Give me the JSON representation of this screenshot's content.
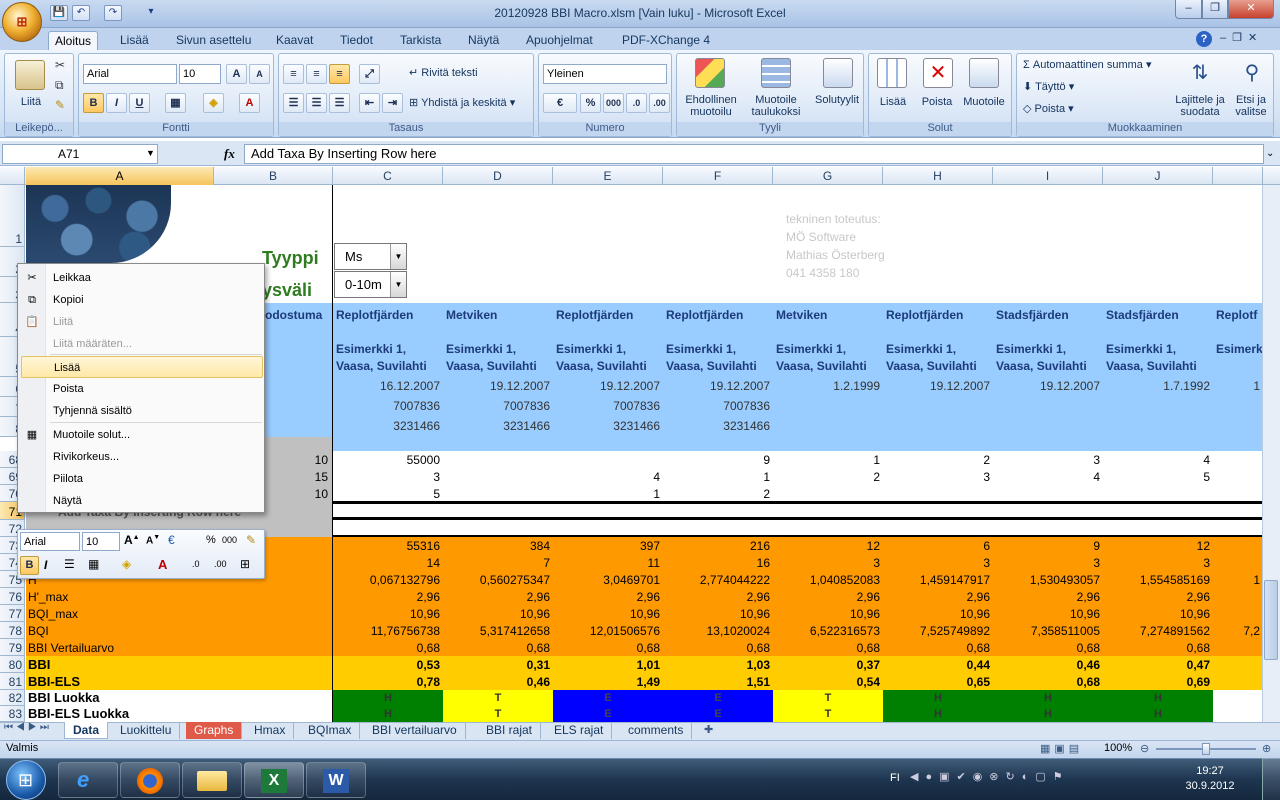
{
  "window": {
    "title": "20120928 BBI Macro.xlsm  [Vain luku] - Microsoft Excel",
    "min": "–",
    "max": "❐",
    "close": "✕"
  },
  "qat": {
    "save": "💾",
    "undo": "↶",
    "redo": "↷",
    "more": "▾"
  },
  "tabs": [
    "Aloitus",
    "Lisää",
    "Sivun asettelu",
    "Kaavat",
    "Tiedot",
    "Tarkista",
    "Näytä",
    "Apuohjelmat",
    "PDF-XChange 4"
  ],
  "ribbon": {
    "clipboard": {
      "label": "Leikepö...",
      "paste": "Liitä"
    },
    "font": {
      "label": "Fontti",
      "name": "Arial",
      "size": "10",
      "bold": "B",
      "italic": "I",
      "underline": "U",
      "grow": "A",
      "shrink": "A"
    },
    "alignment": {
      "label": "Tasaus",
      "wrap": "Rivitä teksti",
      "merge": "Yhdistä ja keskitä"
    },
    "number": {
      "label": "Numero",
      "format": "Yleinen",
      "percent": "%",
      "thousands": "000"
    },
    "styles": {
      "label": "Tyyli",
      "conditional": [
        "Ehdollinen",
        "muotoilu"
      ],
      "table": [
        "Muotoile",
        "taulukoksi"
      ],
      "cell": "Solutyylit"
    },
    "cells": {
      "label": "Solut",
      "insert": "Lisää",
      "delete": "Poista",
      "format": "Muotoile"
    },
    "editing": {
      "label": "Muokkaaminen",
      "autosum": "Automaattinen summa",
      "fill": "Täyttö",
      "clear": "Poista",
      "sort": [
        "Lajittele ja",
        "suodata"
      ],
      "find": [
        "Etsi ja",
        "valitse"
      ]
    }
  },
  "formula_bar": {
    "name_box": "A71",
    "fx": "fx",
    "formula": "Add Taxa By Inserting Row here"
  },
  "columns": [
    "A",
    "B",
    "C",
    "D",
    "E",
    "F",
    "G",
    "H",
    "I",
    "J"
  ],
  "rows": [
    "1",
    "2",
    "3",
    "4",
    "5",
    "6",
    "7",
    "8",
    "68",
    "69",
    "70",
    "71",
    "72",
    "73",
    "74",
    "75",
    "76",
    "77",
    "78",
    "79",
    "80",
    "81",
    "82",
    "83"
  ],
  "sheet": {
    "credit": [
      "tekninen toteutus:",
      "MÖ Software",
      "Mathias Österberg",
      "041 4358 180"
    ],
    "tyyppi_label": "Tyyppi",
    "tyyppi_value": "Ms",
    "syvyys_label": "ysväli",
    "syvyys_value": "0-10m",
    "row4_b": "odostuma",
    "sites": [
      "Replotfjärden",
      "Metviken",
      "Replotfjärden",
      "Replotfjärden",
      "Metviken",
      "Replotfjärden",
      "Stadsfjärden",
      "Stadsfjärden",
      "Replotf"
    ],
    "example": [
      "Esimerkki 1,",
      "Esimerkki 1,",
      "Esimerkki 1,",
      "Esimerkki 1,",
      "Esimerkki 1,",
      "Esimerkki 1,",
      "Esimerkki 1,",
      "Esimerkki 1,",
      "Esimerk"
    ],
    "location": [
      "Vaasa, Suvilahti",
      "Vaasa, Suvilahti",
      "Vaasa, Suvilahti",
      "Vaasa, Suvilahti",
      "Vaasa, Suvilahti",
      "Vaasa, Suvilahti",
      "Vaasa, Suvilahti",
      "Vaasa, Suvilahti",
      ""
    ],
    "dates": [
      "16.12.2007",
      "19.12.2007",
      "19.12.2007",
      "19.12.2007",
      "1.2.1999",
      "19.12.2007",
      "19.12.2007",
      "1.7.1992",
      "1"
    ],
    "row7": [
      "7007836",
      "7007836",
      "7007836",
      "7007836",
      "",
      "",
      "",
      "",
      ""
    ],
    "row8": [
      "3231466",
      "3231466",
      "3231466",
      "3231466",
      "",
      "",
      "",
      "",
      ""
    ],
    "row68": {
      "b": "10",
      "vals": [
        "55000",
        "",
        "",
        "9",
        "1",
        "2",
        "3",
        "4",
        ""
      ]
    },
    "row69": {
      "b": "15",
      "vals": [
        "3",
        "",
        "4",
        "1",
        "2",
        "3",
        "4",
        "5",
        ""
      ]
    },
    "row70": {
      "b": "10",
      "vals": [
        "5",
        "",
        "1",
        "2",
        "",
        "",
        "",
        "",
        ""
      ]
    },
    "row71_a": "Add Taxa By Inserting Row here",
    "calc": [
      {
        "label": "",
        "vals": [
          "55316",
          "384",
          "397",
          "216",
          "12",
          "6",
          "9",
          "12",
          ""
        ]
      },
      {
        "label": "",
        "vals": [
          "14",
          "7",
          "11",
          "16",
          "3",
          "3",
          "3",
          "3",
          ""
        ]
      },
      {
        "label": "H'",
        "vals": [
          "0,067132796",
          "0,560275347",
          "3,0469701",
          "2,774044222",
          "1,040852083",
          "1,459147917",
          "1,530493057",
          "1,554585169",
          "1"
        ]
      },
      {
        "label": "H'_max",
        "vals": [
          "2,96",
          "2,96",
          "2,96",
          "2,96",
          "2,96",
          "2,96",
          "2,96",
          "2,96",
          ""
        ]
      },
      {
        "label": "BQI_max",
        "vals": [
          "10,96",
          "10,96",
          "10,96",
          "10,96",
          "10,96",
          "10,96",
          "10,96",
          "10,96",
          ""
        ]
      },
      {
        "label": "BQI",
        "vals": [
          "11,76756738",
          "5,317412658",
          "12,01506576",
          "13,1020024",
          "6,522316573",
          "7,525749892",
          "7,358511005",
          "7,274891562",
          "7,2"
        ]
      },
      {
        "label": "BBI Vertailuarvo",
        "vals": [
          "0,68",
          "0,68",
          "0,68",
          "0,68",
          "0,68",
          "0,68",
          "0,68",
          "0,68",
          ""
        ]
      }
    ],
    "bbi": {
      "label": "BBI",
      "vals": [
        "0,53",
        "0,31",
        "1,01",
        "1,03",
        "0,37",
        "0,44",
        "0,46",
        "0,47",
        ""
      ]
    },
    "bbi_els": {
      "label": "BBI-ELS",
      "vals": [
        "0,78",
        "0,46",
        "1,49",
        "1,51",
        "0,54",
        "0,65",
        "0,68",
        "0,69",
        ""
      ]
    },
    "luokka": {
      "label": "BBI Luokka",
      "vals": [
        "H",
        "T",
        "E",
        "E",
        "T",
        "H",
        "H",
        "H",
        ""
      ]
    },
    "els_luokka": {
      "label": "BBI-ELS Luokka",
      "vals": [
        "H",
        "T",
        "E",
        "E",
        "T",
        "H",
        "H",
        "H",
        ""
      ]
    },
    "class_colors": {
      "H": "#008000",
      "T": "#ffff00",
      "E": "#0000ff"
    }
  },
  "context_menu": [
    {
      "label": "Leikkaa",
      "icon": "✂",
      "state": "normal"
    },
    {
      "label": "Kopioi",
      "icon": "⧉",
      "state": "normal"
    },
    {
      "label": "Liitä",
      "icon": "📋",
      "state": "disabled"
    },
    {
      "label": "Liitä määräten...",
      "icon": "",
      "state": "disabled"
    },
    {
      "label": "Lisää",
      "icon": "",
      "state": "highlight"
    },
    {
      "label": "Poista",
      "icon": "",
      "state": "normal"
    },
    {
      "label": "Tyhjennä sisältö",
      "icon": "",
      "state": "normal"
    },
    {
      "label": "Muotoile solut...",
      "icon": "▦",
      "state": "normal"
    },
    {
      "label": "Rivikorkeus...",
      "icon": "",
      "state": "normal"
    },
    {
      "label": "Piilota",
      "icon": "",
      "state": "normal"
    },
    {
      "label": "Näytä",
      "icon": "",
      "state": "normal"
    }
  ],
  "mini_toolbar": {
    "font": "Arial",
    "size": "10",
    "bold": "B",
    "italic": "I",
    "percent": "%",
    "thousands": "000"
  },
  "sheet_tabs": [
    "Data",
    "Luokittelu",
    "Graphs",
    "Hmax",
    "BQImax",
    "BBI vertailuarvo",
    "BBI rajat",
    "ELS rajat",
    "comments"
  ],
  "status": {
    "ready": "Valmis",
    "zoom": "100%",
    "zoom_value": 100
  },
  "taskbar": {
    "lang": "FI",
    "time": "19:27",
    "date": "30.9.2012"
  },
  "colors": {
    "header_blue": "#99ccff",
    "orange": "#ff9900",
    "gold": "#ffcc00",
    "gray": "#c0c0c0"
  }
}
